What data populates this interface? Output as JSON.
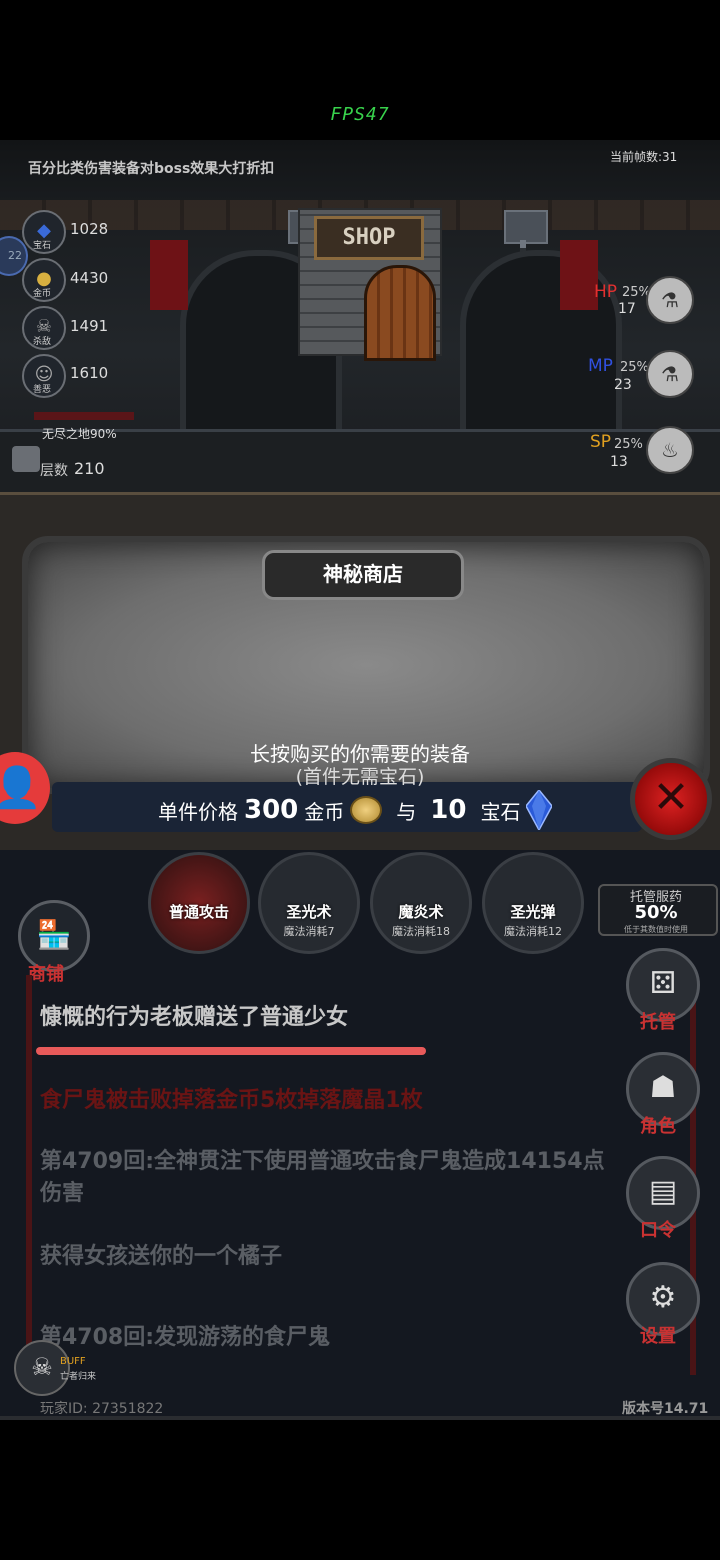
{
  "hud": {
    "fps": "FPS47",
    "top_notice": "百分比类伤害装备对boss效果大打折扣",
    "frame_count": "当前帧数:31",
    "level_badge": "22",
    "resources": [
      {
        "icon": "gem-icon",
        "tag": "宝石",
        "value": "1028"
      },
      {
        "icon": "coin-icon",
        "tag": "金币",
        "value": "4430"
      },
      {
        "icon": "skull-icon",
        "tag": "杀敌",
        "value": "1491"
      },
      {
        "icon": "mask-icon",
        "tag": "善恶",
        "value": "1610"
      }
    ],
    "zone": "无尽之地90%",
    "floor_label": "层数",
    "floor_value": "210",
    "stats": [
      {
        "label": "HP",
        "pct": "25%",
        "value": "17",
        "color": "#e03030"
      },
      {
        "label": "MP",
        "pct": "25%",
        "value": "23",
        "color": "#3050e0"
      },
      {
        "label": "SP",
        "pct": "25%",
        "value": "13",
        "color": "#e0a020"
      }
    ],
    "shop_sign": "SHOP"
  },
  "dialog": {
    "title": "神秘商店",
    "instruction": "长按购买的你需要的装备",
    "note": "(首件无需宝石)",
    "price_prefix": "单件价格",
    "gold_amount": "300",
    "gold_unit": "金币",
    "conjunction": "与",
    "gem_amount": "10",
    "gem_unit": "宝石",
    "close_symbol": "✕"
  },
  "skills": [
    {
      "name": "普通攻击",
      "cost": ""
    },
    {
      "name": "圣光术",
      "cost": "魔法消耗7"
    },
    {
      "name": "魔炎术",
      "cost": "魔法消耗18"
    },
    {
      "name": "圣光弹",
      "cost": "魔法消耗12"
    }
  ],
  "auto_potion": {
    "title": "托管服药",
    "value": "50%",
    "sub": "低于其数值时使用"
  },
  "shop_button": {
    "label": "商铺"
  },
  "side_menu": [
    {
      "label": "托管",
      "icon": "dice-icon"
    },
    {
      "label": "角色",
      "icon": "hood-icon"
    },
    {
      "label": "口令",
      "icon": "book-icon"
    },
    {
      "label": "设置",
      "icon": "gear-icon"
    }
  ],
  "log": [
    {
      "text": "慷慨的行为老板赠送了普通少女",
      "color": "#c8c8c8"
    },
    {
      "text": "食尸鬼被击败掉落金币5枚掉落魔晶1枚",
      "color": "#6a1414"
    },
    {
      "text": "第4709回:全神贯注下使用普通攻击食尸鬼造成14154点伤害",
      "color": "#5a5e64"
    },
    {
      "text": "获得女孩送你的一个橘子",
      "color": "#5a5e64"
    },
    {
      "text": "第4708回:发现游荡的食尸鬼",
      "color": "#5a5e64"
    }
  ],
  "buff": {
    "label": "BUFF",
    "sub": "亡者归来"
  },
  "footer": {
    "player_id": "玩家ID: 27351822",
    "version": "版本号14.71"
  }
}
